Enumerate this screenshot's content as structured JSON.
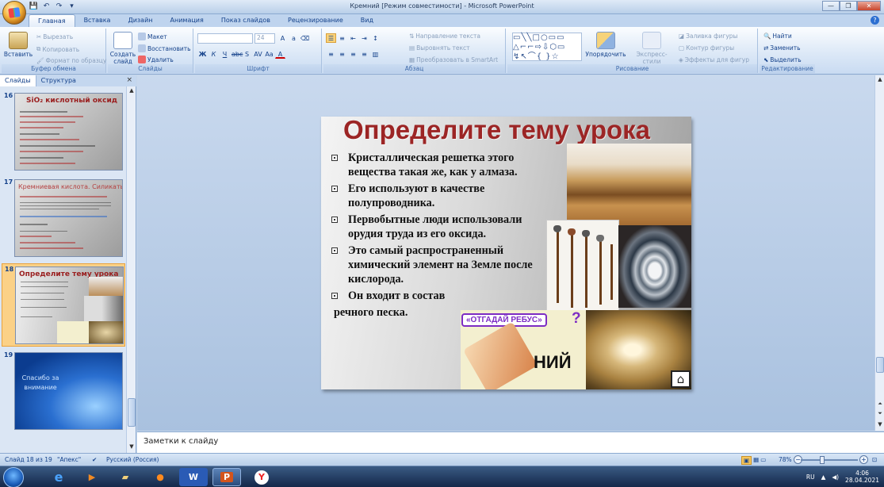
{
  "window": {
    "title": "Кремний [Режим совместимости] - Microsoft PowerPoint",
    "qat": [
      "save-icon",
      "undo-icon",
      "redo-icon",
      "customize-icon"
    ],
    "controls": [
      "—",
      "❐",
      "✕"
    ]
  },
  "tabs": [
    "Главная",
    "Вставка",
    "Дизайн",
    "Анимация",
    "Показ слайдов",
    "Рецензирование",
    "Вид"
  ],
  "ribbon": {
    "clipboard": {
      "label": "Буфер обмена",
      "paste": "Вставить",
      "cut": "Вырезать",
      "copy": "Копировать",
      "format_painter": "Формат по образцу"
    },
    "slides": {
      "label": "Слайды",
      "new_slide": "Создать слайд",
      "layout": "Макет",
      "reset": "Восстановить",
      "delete": "Удалить"
    },
    "font": {
      "label": "Шрифт",
      "size": "24"
    },
    "paragraph": {
      "label": "Абзац",
      "text_direction": "Направление текста",
      "align_text": "Выровнять текст",
      "smartart": "Преобразовать в SmartArt"
    },
    "drawing": {
      "label": "Рисование",
      "arrange": "Упорядочить",
      "quick_styles": "Экспресс-стили",
      "fill": "Заливка фигуры",
      "outline": "Контур фигуры",
      "effects": "Эффекты для фигур"
    },
    "editing": {
      "label": "Редактирование",
      "find": "Найти",
      "replace": "Заменить",
      "select": "Выделить"
    }
  },
  "panel": {
    "tabs": [
      "Слайды",
      "Структура"
    ],
    "close": "×",
    "thumbs": [
      {
        "num": "16",
        "title": "SiO₂ кислотный оксид"
      },
      {
        "num": "17",
        "title": "Кремниевая кислота. Силикаты"
      },
      {
        "num": "18",
        "title": "Определите тему урока"
      },
      {
        "num": "19",
        "title": "Спасибо за внимание"
      }
    ]
  },
  "slide": {
    "title": "Определите тему урока",
    "bullets": [
      "Кристаллическая решетка этого вещества такая же, как у алмаза.",
      "Его используют в качестве полупроводника.",
      "Первобытные люди использовали орудия труда из его оксида.",
      "Это самый распространенный химический элемент на Земле после кислорода.",
      "Он входит в состав"
    ],
    "last_line": "речного песка.",
    "rebus_label": "«ОТГАДАЙ РЕБУС»",
    "rebus_question": "?",
    "rebus_word": "НИЙ",
    "home_icon": "home-icon"
  },
  "notes": {
    "placeholder": "Заметки к слайду"
  },
  "status": {
    "slide_of": "Слайд 18 из 19",
    "theme": "\"Апекс\"",
    "language": "Русский (Россия)",
    "zoom": "78%"
  },
  "taskbar": {
    "lang": "RU",
    "time": "4:06",
    "date": "28.04.2021"
  }
}
